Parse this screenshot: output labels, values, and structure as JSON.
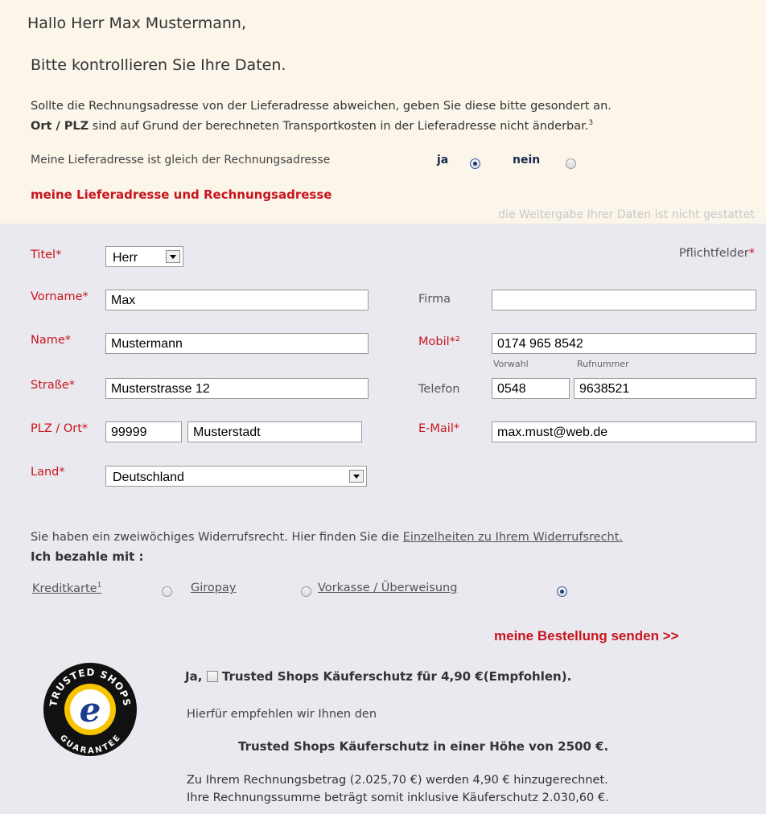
{
  "greeting": "Hallo Herr Max Mustermann,",
  "check_text": "Bitte kontrollieren Sie Ihre Daten.",
  "info_line1": "Sollte die Rechnungsadresse von der Lieferadresse abweichen, geben Sie diese bitte gesondert an.",
  "info_line2_bold": "Ort / PLZ",
  "info_line2_rest": " sind auf Grund der berechneten Transportkosten in der Lieferadresse nicht änderbar.",
  "info_line2_sup": "3",
  "same_address": {
    "question": "Meine Lieferadresse ist gleich der Rechnungsadresse",
    "yes_label": "ja",
    "no_label": "nein",
    "selected": "ja"
  },
  "section_title": "meine Lieferadresse und Rechnungsadresse",
  "no_share_note": "die Weitergabe Ihrer Daten ist nicht gestattet",
  "required_note": "Pflichtfelder",
  "required_star": "*",
  "fields": {
    "titel_label": "Titel*",
    "titel_value": "Herr",
    "vorname_label": "Vorname*",
    "vorname_value": "Max",
    "name_label": "Name*",
    "name_value": "Mustermann",
    "strasse_label": "Straße*",
    "strasse_value": "Musterstrasse 12",
    "plzort_label": "PLZ / Ort*",
    "plz_value": "99999",
    "ort_value": "Musterstadt",
    "land_label": "Land*",
    "land_value": "Deutschland",
    "firma_label": "Firma",
    "firma_value": "",
    "mobil_label": "Mobil*²",
    "mobil_value": "0174 965 8542",
    "vorwahl_caption": "Vorwahl",
    "rufnummer_caption": "Rufnummer",
    "telefon_label": "Telefon",
    "vorwahl_value": "0548",
    "rufnummer_value": "9638521",
    "email_label": "E-Mail*",
    "email_value": "max.must@web.de"
  },
  "widerruf_text": "Sie haben ein zweiwöchiges Widerrufsrecht. Hier finden Sie die ",
  "widerruf_link": "Einzelheiten zu Ihrem Widerrufsrecht.",
  "payment": {
    "heading": "Ich bezahle mit :",
    "kreditkarte": "Kreditkarte",
    "kreditkarte_sup": "1",
    "giropay": "Giropay",
    "vorkasse": "Vorkasse / Überweisung",
    "selected": "vorkasse"
  },
  "send_button": "meine Bestellung senden >>",
  "trusted": {
    "ja": "Ja,",
    "offer": "Trusted Shops Käuferschutz für 4,90 €(Empfohlen).",
    "recommend": "Hierfür empfehlen wir Ihnen den",
    "amount": "Trusted Shops Käuferschutz in einer Höhe von 2500 €.",
    "line1": "Zu Ihrem Rechnungsbetrag (2.025,70 €) werden 4,90 € hinzugerechnet.",
    "line2": "Ihre Rechnungssumme beträgt somit inklusive Käuferschutz 2.030,60 €.",
    "seal_top": "TRUSTED SHOPS",
    "seal_bottom": "GUARANTEE",
    "seal_letter": "e"
  }
}
